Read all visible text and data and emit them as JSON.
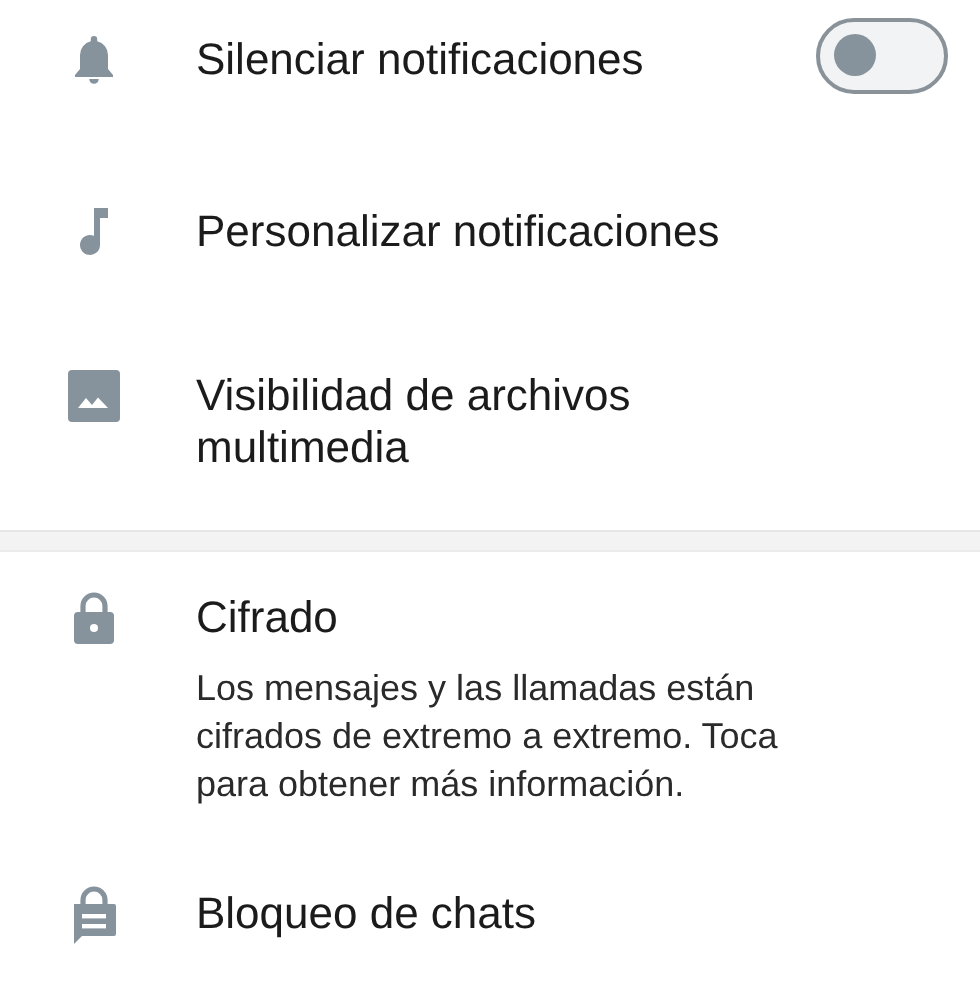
{
  "sections": [
    {
      "items": [
        {
          "title": "Silenciar notificaciones",
          "toggle": {
            "on": false
          }
        },
        {
          "title": "Personalizar notificaciones"
        },
        {
          "title": "Visibilidad de archivos multimedia"
        }
      ]
    },
    {
      "items": [
        {
          "title": "Cifrado",
          "description": "Los mensajes y las llamadas están cifrados de extremo a extremo. Toca para obtener más información."
        },
        {
          "title": "Bloqueo de chats"
        }
      ]
    }
  ]
}
